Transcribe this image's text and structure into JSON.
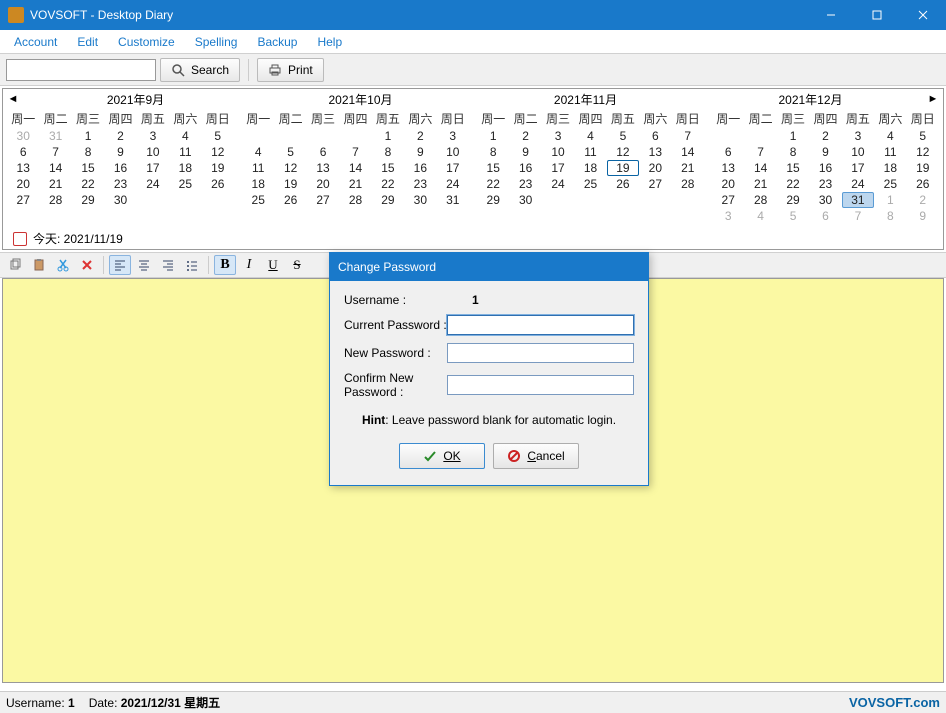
{
  "window": {
    "title": "VOVSOFT - Desktop Diary"
  },
  "menu": {
    "items": [
      "Account",
      "Edit",
      "Customize",
      "Spelling",
      "Backup",
      "Help"
    ]
  },
  "toolbar": {
    "search_placeholder": "",
    "search_label": "Search",
    "print_label": "Print"
  },
  "calendar": {
    "months": [
      {
        "title": "2021年9月",
        "dow": [
          "周一",
          "周二",
          "周三",
          "周四",
          "周五",
          "周六",
          "周日"
        ],
        "rows": [
          [
            {
              "d": "30",
              "dim": true
            },
            {
              "d": "31",
              "dim": true
            },
            {
              "d": "1"
            },
            {
              "d": "2"
            },
            {
              "d": "3"
            },
            {
              "d": "4"
            },
            {
              "d": "5"
            }
          ],
          [
            {
              "d": "6"
            },
            {
              "d": "7"
            },
            {
              "d": "8"
            },
            {
              "d": "9"
            },
            {
              "d": "10"
            },
            {
              "d": "11"
            },
            {
              "d": "12"
            }
          ],
          [
            {
              "d": "13"
            },
            {
              "d": "14"
            },
            {
              "d": "15"
            },
            {
              "d": "16"
            },
            {
              "d": "17"
            },
            {
              "d": "18"
            },
            {
              "d": "19"
            }
          ],
          [
            {
              "d": "20"
            },
            {
              "d": "21"
            },
            {
              "d": "22"
            },
            {
              "d": "23"
            },
            {
              "d": "24"
            },
            {
              "d": "25"
            },
            {
              "d": "26"
            }
          ],
          [
            {
              "d": "27"
            },
            {
              "d": "28"
            },
            {
              "d": "29"
            },
            {
              "d": "30"
            },
            {
              "d": ""
            },
            {
              "d": ""
            },
            {
              "d": ""
            }
          ],
          [
            {
              "d": ""
            },
            {
              "d": ""
            },
            {
              "d": ""
            },
            {
              "d": ""
            },
            {
              "d": ""
            },
            {
              "d": ""
            },
            {
              "d": ""
            }
          ]
        ]
      },
      {
        "title": "2021年10月",
        "dow": [
          "周一",
          "周二",
          "周三",
          "周四",
          "周五",
          "周六",
          "周日"
        ],
        "rows": [
          [
            {
              "d": ""
            },
            {
              "d": ""
            },
            {
              "d": ""
            },
            {
              "d": ""
            },
            {
              "d": "1"
            },
            {
              "d": "2"
            },
            {
              "d": "3"
            }
          ],
          [
            {
              "d": "4"
            },
            {
              "d": "5"
            },
            {
              "d": "6"
            },
            {
              "d": "7"
            },
            {
              "d": "8"
            },
            {
              "d": "9"
            },
            {
              "d": "10"
            }
          ],
          [
            {
              "d": "11"
            },
            {
              "d": "12"
            },
            {
              "d": "13"
            },
            {
              "d": "14"
            },
            {
              "d": "15"
            },
            {
              "d": "16"
            },
            {
              "d": "17"
            }
          ],
          [
            {
              "d": "18"
            },
            {
              "d": "19"
            },
            {
              "d": "20"
            },
            {
              "d": "21"
            },
            {
              "d": "22"
            },
            {
              "d": "23"
            },
            {
              "d": "24"
            }
          ],
          [
            {
              "d": "25"
            },
            {
              "d": "26"
            },
            {
              "d": "27"
            },
            {
              "d": "28"
            },
            {
              "d": "29"
            },
            {
              "d": "30"
            },
            {
              "d": "31"
            }
          ],
          [
            {
              "d": ""
            },
            {
              "d": ""
            },
            {
              "d": ""
            },
            {
              "d": ""
            },
            {
              "d": ""
            },
            {
              "d": ""
            },
            {
              "d": ""
            }
          ]
        ]
      },
      {
        "title": "2021年11月",
        "dow": [
          "周一",
          "周二",
          "周三",
          "周四",
          "周五",
          "周六",
          "周日"
        ],
        "rows": [
          [
            {
              "d": "1"
            },
            {
              "d": "2"
            },
            {
              "d": "3"
            },
            {
              "d": "4"
            },
            {
              "d": "5"
            },
            {
              "d": "6"
            },
            {
              "d": "7"
            }
          ],
          [
            {
              "d": "8"
            },
            {
              "d": "9"
            },
            {
              "d": "10"
            },
            {
              "d": "11"
            },
            {
              "d": "12"
            },
            {
              "d": "13"
            },
            {
              "d": "14"
            }
          ],
          [
            {
              "d": "15"
            },
            {
              "d": "16"
            },
            {
              "d": "17"
            },
            {
              "d": "18"
            },
            {
              "d": "19",
              "today": true
            },
            {
              "d": "20"
            },
            {
              "d": "21"
            }
          ],
          [
            {
              "d": "22"
            },
            {
              "d": "23"
            },
            {
              "d": "24"
            },
            {
              "d": "25"
            },
            {
              "d": "26"
            },
            {
              "d": "27"
            },
            {
              "d": "28"
            }
          ],
          [
            {
              "d": "29"
            },
            {
              "d": "30"
            },
            {
              "d": ""
            },
            {
              "d": ""
            },
            {
              "d": ""
            },
            {
              "d": ""
            },
            {
              "d": ""
            }
          ],
          [
            {
              "d": ""
            },
            {
              "d": ""
            },
            {
              "d": ""
            },
            {
              "d": ""
            },
            {
              "d": ""
            },
            {
              "d": ""
            },
            {
              "d": ""
            }
          ]
        ]
      },
      {
        "title": "2021年12月",
        "dow": [
          "周一",
          "周二",
          "周三",
          "周四",
          "周五",
          "周六",
          "周日"
        ],
        "rows": [
          [
            {
              "d": ""
            },
            {
              "d": ""
            },
            {
              "d": "1"
            },
            {
              "d": "2"
            },
            {
              "d": "3"
            },
            {
              "d": "4"
            },
            {
              "d": "5"
            }
          ],
          [
            {
              "d": "6"
            },
            {
              "d": "7"
            },
            {
              "d": "8"
            },
            {
              "d": "9"
            },
            {
              "d": "10"
            },
            {
              "d": "11"
            },
            {
              "d": "12"
            }
          ],
          [
            {
              "d": "13"
            },
            {
              "d": "14"
            },
            {
              "d": "15"
            },
            {
              "d": "16"
            },
            {
              "d": "17"
            },
            {
              "d": "18"
            },
            {
              "d": "19"
            }
          ],
          [
            {
              "d": "20"
            },
            {
              "d": "21"
            },
            {
              "d": "22"
            },
            {
              "d": "23"
            },
            {
              "d": "24"
            },
            {
              "d": "25"
            },
            {
              "d": "26"
            }
          ],
          [
            {
              "d": "27"
            },
            {
              "d": "28"
            },
            {
              "d": "29"
            },
            {
              "d": "30"
            },
            {
              "d": "31",
              "sel": true
            },
            {
              "d": "1",
              "dim": true
            },
            {
              "d": "2",
              "dim": true
            }
          ],
          [
            {
              "d": "3",
              "dim": true
            },
            {
              "d": "4",
              "dim": true
            },
            {
              "d": "5",
              "dim": true
            },
            {
              "d": "6",
              "dim": true
            },
            {
              "d": "7",
              "dim": true
            },
            {
              "d": "8",
              "dim": true
            },
            {
              "d": "9",
              "dim": true
            }
          ]
        ]
      }
    ],
    "today_label": "今天: 2021/11/19"
  },
  "dialog": {
    "title": "Change Password",
    "username_label": "Username :",
    "username_value": "1",
    "current_pw_label": "Current Password :",
    "new_pw_label": "New Password :",
    "confirm_pw_label": "Confirm New Password :",
    "hint_label": "Hint",
    "hint_text": ": Leave password blank for automatic login.",
    "ok_label": "OK",
    "cancel_label": "Cancel"
  },
  "status": {
    "username_label": "Username:",
    "username_value": "1",
    "date_label": "Date:",
    "date_value": "2021/12/31 星期五",
    "brand": "VOVSOFT.com"
  }
}
